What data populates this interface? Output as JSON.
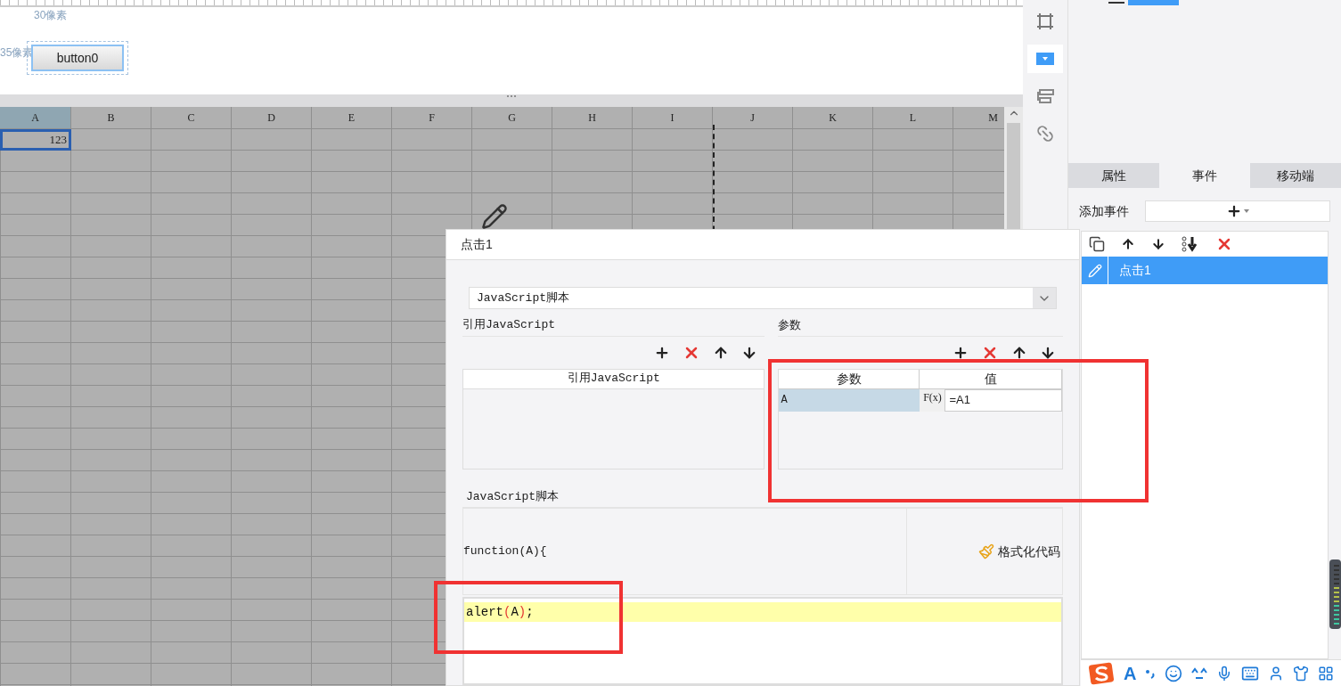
{
  "canvas": {
    "width_label": "30像素",
    "height_label": "35像素",
    "button": "button0"
  },
  "sheet": {
    "columns": [
      {
        "label": "A",
        "selected": true
      },
      {
        "label": "B",
        "selected": false
      },
      {
        "label": "C",
        "selected": false
      },
      {
        "label": "D",
        "selected": false
      },
      {
        "label": "E",
        "selected": false
      },
      {
        "label": "F",
        "selected": false
      },
      {
        "label": "G",
        "selected": false
      },
      {
        "label": "H",
        "selected": false
      },
      {
        "label": "I",
        "selected": false
      },
      {
        "label": "J",
        "selected": false
      },
      {
        "label": "K",
        "selected": false
      },
      {
        "label": "L",
        "selected": false
      },
      {
        "label": "M",
        "selected": false
      }
    ],
    "cells": [
      {
        "text": "123",
        "selected": true
      }
    ]
  },
  "toolstrip": [
    {
      "kind": "frame",
      "selected": false
    },
    {
      "kind": "combo",
      "selected": true
    },
    {
      "kind": "layout",
      "selected": false
    },
    {
      "kind": "link",
      "selected": false
    }
  ],
  "panel": {
    "tabs": [
      {
        "label": "属性",
        "selected": false
      },
      {
        "label": "事件",
        "selected": true
      },
      {
        "label": "移动端",
        "selected": false
      }
    ],
    "add_event_label": "添加事件",
    "events": [
      {
        "name": "点击1",
        "selected": true
      }
    ]
  },
  "dialog": {
    "title": "点击1",
    "type_select": "JavaScript脚本",
    "ref_section": {
      "title": "引用JavaScript",
      "column": "引用JavaScript"
    },
    "params_section": {
      "title": "参数",
      "columns": [
        "参数",
        "值"
      ],
      "rows": [
        {
          "name": "A",
          "formula_glyph": "F(x)",
          "value": "=A1"
        }
      ]
    },
    "script_section": {
      "title": "JavaScript脚本",
      "header": "function(A){",
      "format_button": "格式化代码",
      "code": [
        [
          {
            "text": "alert",
            "kind": "plain"
          },
          {
            "text": "(",
            "kind": "paren"
          },
          {
            "text": "A",
            "kind": "plain"
          },
          {
            "text": ")",
            "kind": "paren"
          },
          {
            "text": ";",
            "kind": "plain"
          }
        ]
      ]
    }
  },
  "ime_bar": {
    "letter": "A"
  }
}
